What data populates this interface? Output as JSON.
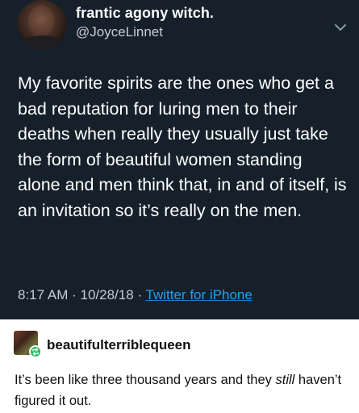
{
  "tweet": {
    "display_name": "frantic agony witch.",
    "handle": "@JoyceLinnet",
    "text": "My favorite spirits are the ones who get a bad reputation for luring men to their deaths when really they usually just take the form of beautiful women standing alone and men think that, in and of itself, is an invitation so it’s really on the men.",
    "time": "8:17 AM",
    "date": "10/28/18",
    "separator": "·",
    "source": "Twitter for iPhone",
    "background": "#15202b",
    "link_color": "#1da1f2"
  },
  "reply": {
    "username": "beautifulterriblequeen",
    "text_before": "It’s been like three thousand years and they ",
    "text_emphasis": "still",
    "text_after": " haven’t figured it out.",
    "badge_color": "#22c15e"
  },
  "icons": {
    "menu": "chevron-down-icon",
    "reblog": "reblog-icon"
  }
}
